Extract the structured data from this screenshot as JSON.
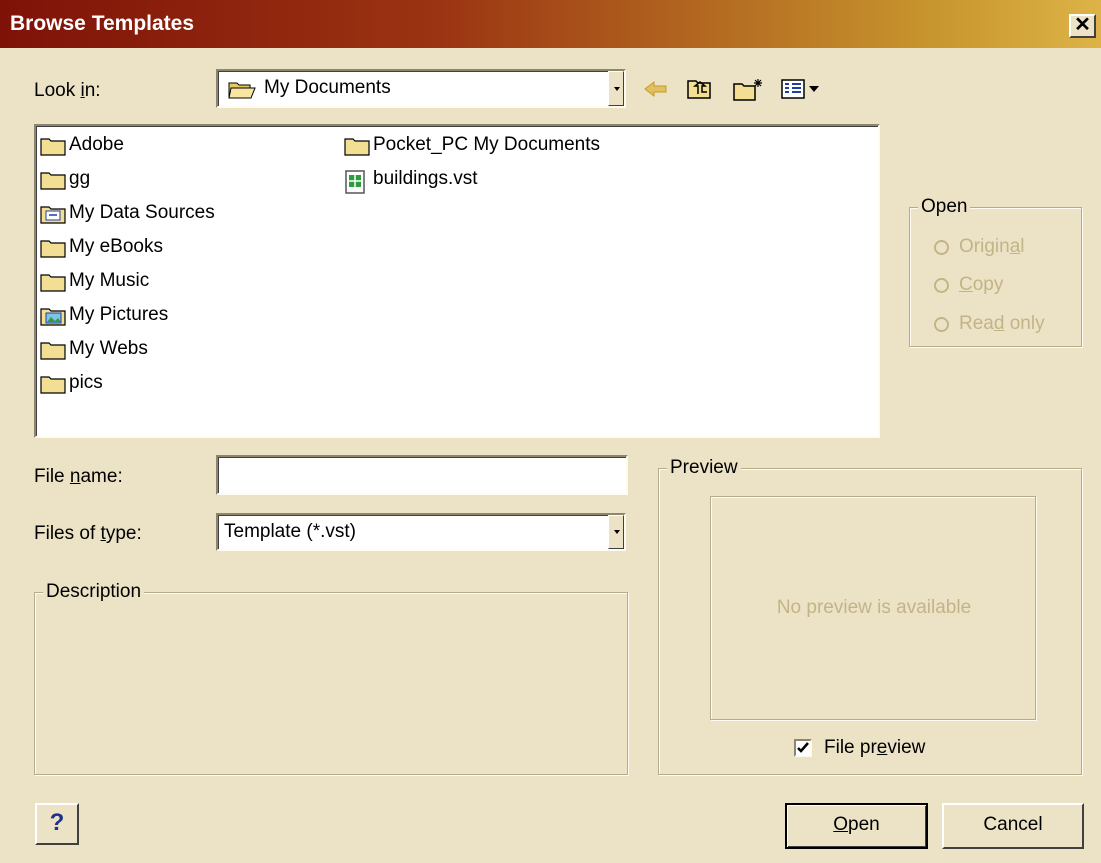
{
  "window": {
    "title": "Browse Templates",
    "close_label": "x"
  },
  "lookin": {
    "label_pre": "Look ",
    "label_u": "i",
    "label_post": "n:",
    "value": "My Documents"
  },
  "toolbar": {
    "icons": [
      "back-arrow-icon",
      "up-one-level-icon",
      "create-new-folder-icon",
      "views-menu-icon"
    ]
  },
  "files": {
    "col1": [
      {
        "name": "Adobe",
        "icon": "folder-icon"
      },
      {
        "name": "gg",
        "icon": "folder-icon"
      },
      {
        "name": "My Data Sources",
        "icon": "data-sources-folder-icon"
      },
      {
        "name": "My eBooks",
        "icon": "folder-icon"
      },
      {
        "name": "My Music",
        "icon": "folder-icon"
      },
      {
        "name": "My Pictures",
        "icon": "pictures-folder-icon"
      },
      {
        "name": "My Webs",
        "icon": "folder-icon"
      },
      {
        "name": "pics",
        "icon": "folder-icon"
      }
    ],
    "col2": [
      {
        "name": "Pocket_PC My Documents",
        "icon": "folder-icon"
      },
      {
        "name": "buildings.vst",
        "icon": "visio-template-file-icon"
      }
    ]
  },
  "open_group": {
    "legend": "Open",
    "options": [
      {
        "pre": "",
        "u": "",
        "post": "Origin",
        "u2": "a",
        "post2": "l"
      },
      {
        "pre": "",
        "u": "C",
        "post": "opy",
        "u2": "",
        "post2": ""
      },
      {
        "pre": "Rea",
        "u": "d",
        "post": " only",
        "u2": "",
        "post2": ""
      }
    ]
  },
  "filename": {
    "label_pre": "File ",
    "label_u": "n",
    "label_post": "ame:",
    "value": ""
  },
  "filetype": {
    "label_pre": "Files of ",
    "label_u": "t",
    "label_post": "ype:",
    "value": "Template (*.vst)"
  },
  "description": {
    "legend": "Description"
  },
  "preview": {
    "legend": "Preview",
    "empty_text": "No preview is available",
    "checkbox_pre": "File pr",
    "checkbox_u": "e",
    "checkbox_post": "view",
    "checked": true
  },
  "buttons": {
    "help": "?",
    "open_u": "O",
    "open_rest": "pen",
    "cancel": "Cancel"
  },
  "colors": {
    "title_start": "#7f1208",
    "title_end": "#ddb347",
    "dialog_bg": "#ece3c6",
    "disabled_text": "#c3b487"
  }
}
